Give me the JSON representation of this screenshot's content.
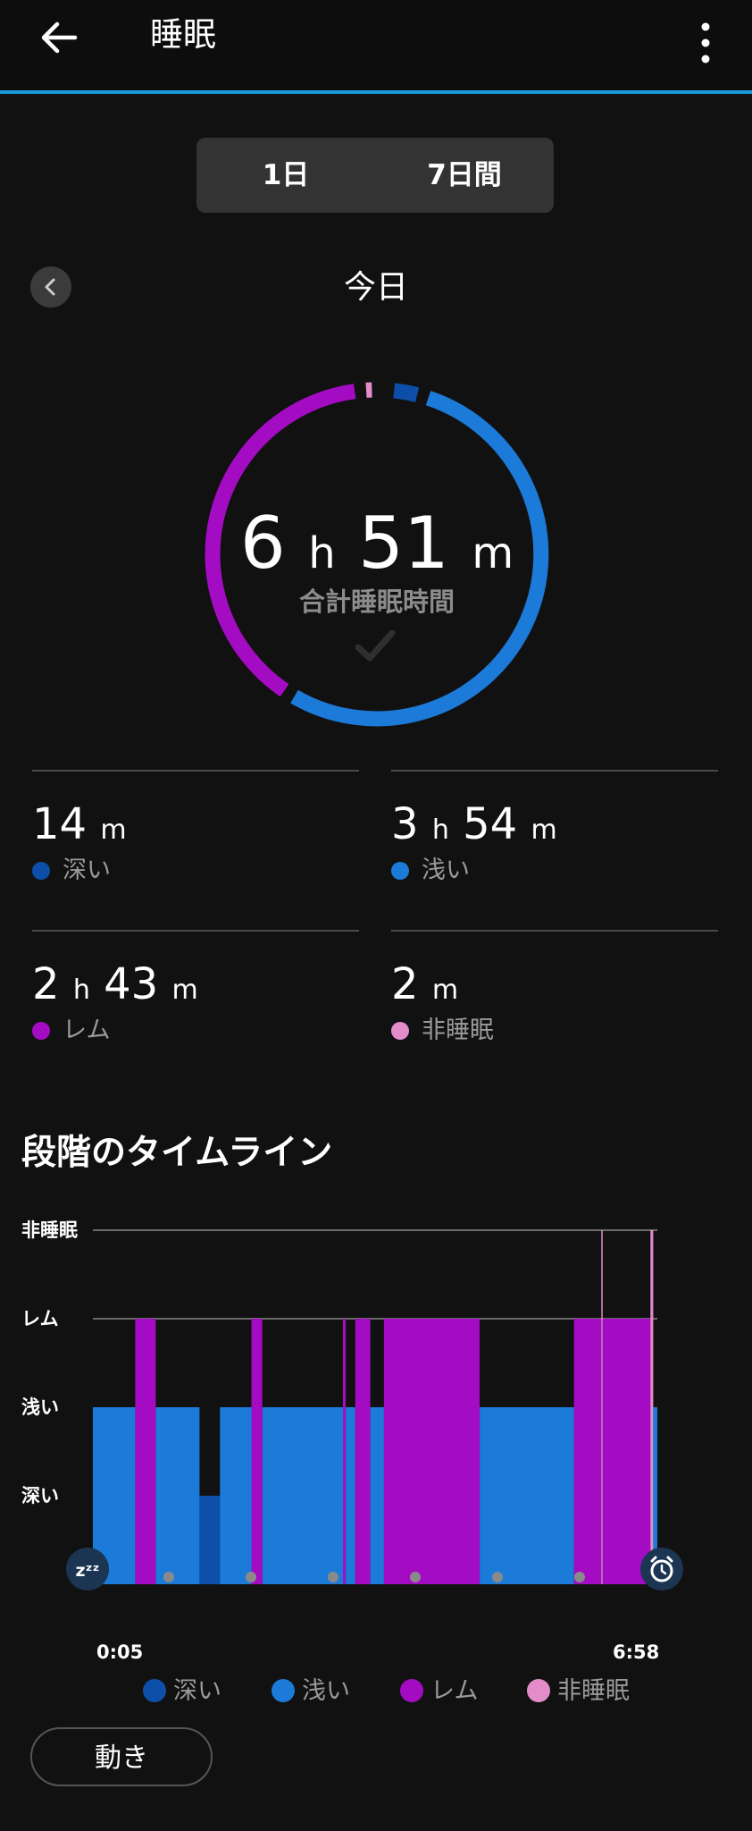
{
  "app_bar": {
    "title": "睡眠",
    "back_icon": "arrow-left-icon",
    "more_icon": "more-vert-icon",
    "accent_color": "#1a9ad8"
  },
  "period_tabs": [
    {
      "label": "1日",
      "selected": true
    },
    {
      "label": "7日間",
      "selected": false
    }
  ],
  "date_nav": {
    "prev_icon": "chevron-left-icon",
    "label": "今日"
  },
  "summary": {
    "total_h": "6",
    "total_m": "51",
    "unit_h": "h",
    "unit_m": "m",
    "total_label": "合計睡眠時間",
    "status_icon": "check-icon"
  },
  "stages": [
    {
      "key": "deep",
      "label": "深い",
      "value_h": "",
      "value_m": "14",
      "color": "#0d4fa8",
      "minutes": 14
    },
    {
      "key": "light",
      "label": "浅い",
      "value_h": "3",
      "value_m": "54",
      "color": "#1c7ad9",
      "minutes": 234
    },
    {
      "key": "rem",
      "label": "レム",
      "value_h": "2",
      "value_m": "43",
      "color": "#a40cc4",
      "minutes": 163
    },
    {
      "key": "awake",
      "label": "非睡眠",
      "value_h": "",
      "value_m": "2",
      "color": "#e48cc9",
      "minutes": 2
    }
  ],
  "timeline": {
    "title": "段階のタイムライン",
    "levels": [
      "非睡眠",
      "レム",
      "浅い",
      "深い"
    ],
    "start_label": "0:05",
    "end_label": "6:58",
    "start_icon": "sleep-zzz-icon",
    "end_icon": "alarm-clock-icon"
  },
  "chart_data": {
    "type": "area",
    "x_unit": "minutes since 0:05",
    "x_range": [
      0,
      413
    ],
    "y_categories": [
      "深い",
      "浅い",
      "レム",
      "非睡眠"
    ],
    "segments": [
      {
        "start": 0,
        "end": 31,
        "stage": "浅い"
      },
      {
        "start": 31,
        "end": 46,
        "stage": "レム"
      },
      {
        "start": 46,
        "end": 78,
        "stage": "浅い"
      },
      {
        "start": 78,
        "end": 93,
        "stage": "深い"
      },
      {
        "start": 93,
        "end": 116,
        "stage": "浅い"
      },
      {
        "start": 116,
        "end": 124,
        "stage": "レム"
      },
      {
        "start": 124,
        "end": 183,
        "stage": "浅い"
      },
      {
        "start": 183,
        "end": 185,
        "stage": "レム"
      },
      {
        "start": 185,
        "end": 192,
        "stage": "浅い"
      },
      {
        "start": 192,
        "end": 203,
        "stage": "レム"
      },
      {
        "start": 203,
        "end": 213,
        "stage": "浅い"
      },
      {
        "start": 213,
        "end": 283,
        "stage": "レム"
      },
      {
        "start": 283,
        "end": 352,
        "stage": "浅い"
      },
      {
        "start": 352,
        "end": 372,
        "stage": "レム"
      },
      {
        "start": 372,
        "end": 373,
        "stage": "非睡眠"
      },
      {
        "start": 373,
        "end": 408,
        "stage": "レム"
      },
      {
        "start": 408,
        "end": 410,
        "stage": "非睡眠"
      },
      {
        "start": 410,
        "end": 413,
        "stage": "浅い"
      }
    ],
    "colors": {
      "深い": "#0d4fa8",
      "浅い": "#1c7ad9",
      "レム": "#a40cc4",
      "非睡眠": "#e48cc9"
    }
  },
  "legend": [
    {
      "label": "深い",
      "color": "#0d4fa8"
    },
    {
      "label": "浅い",
      "color": "#1c7ad9"
    },
    {
      "label": "レム",
      "color": "#a40cc4"
    },
    {
      "label": "非睡眠",
      "color": "#e48cc9"
    }
  ],
  "movement_button": {
    "label": "動き"
  }
}
